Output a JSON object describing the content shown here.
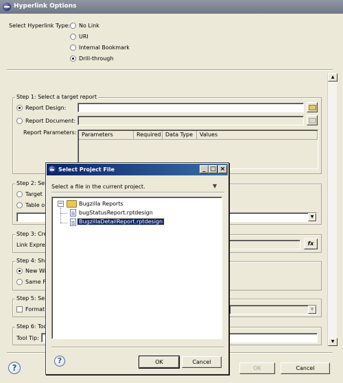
{
  "window": {
    "title": "Hyperlink Options",
    "buttons": {
      "minimize": "_",
      "maximize": "□",
      "close": "×"
    }
  },
  "hyperlink_type": {
    "label": "Select Hyperlink Type:",
    "options": [
      {
        "label": "No Link",
        "selected": false
      },
      {
        "label": "URI",
        "selected": false
      },
      {
        "label": "Internal Bookmark",
        "selected": false
      },
      {
        "label": "Drill-through",
        "selected": true
      }
    ]
  },
  "step1": {
    "title": "Step 1: Select a target report",
    "report_design_label": "Report Design:",
    "report_design_value": "",
    "report_document_label": "Report Document:",
    "report_document_value": "",
    "report_parameters_label": "Report Parameters:",
    "table_headers": [
      "Parameters",
      "Required",
      "Data Type",
      "Values"
    ]
  },
  "step2": {
    "title": "Step 2: Sel",
    "options": [
      "Target",
      "Table o"
    ]
  },
  "step3": {
    "title": "Step 3: Cre",
    "link_expression_label": "Link Expres"
  },
  "step4": {
    "title": "Step 4: Sho",
    "options": [
      "New Wi",
      "Same F"
    ]
  },
  "step5": {
    "title": "Step 5: Sel",
    "format_label": "Format"
  },
  "step6": {
    "title": "Step 6: Too",
    "tooltip_label": "Tool Tip:"
  },
  "footer": {
    "ok_label": "OK",
    "cancel_label": "Cancel"
  },
  "dialog": {
    "title": "Select Project File",
    "buttons": {
      "minimize": "_",
      "maximize": "□",
      "close": "×"
    },
    "instruction": "Select a file in the current project.",
    "tree": {
      "root": "Bugzilla Reports",
      "expander": "−",
      "children": [
        {
          "label": "bugStatusReport.rptdesign",
          "selected": false
        },
        {
          "label": "BugzillaDetailReport.rptdesign",
          "selected": true
        }
      ]
    },
    "ok_label": "OK",
    "cancel_label": "Cancel"
  },
  "icons": {
    "help": "?",
    "expression": "fx",
    "dropdown": "▼",
    "scroll_up": "▲",
    "scroll_down": "▼",
    "menu": "▼"
  }
}
